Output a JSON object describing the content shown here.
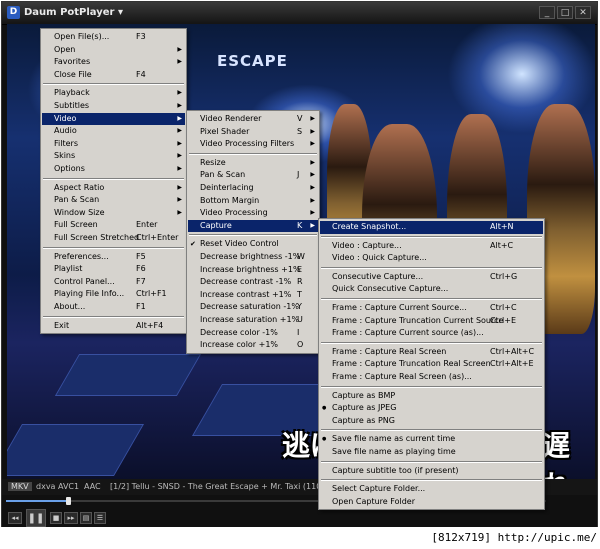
{
  "window": {
    "title": "Daum PotPlayer",
    "title_arrow": "▾"
  },
  "video_overlay": {
    "sign_text": "ESCAPE",
    "subtitle_left": "逃げ",
    "subtitle_right": "遅れ"
  },
  "main_menu": {
    "groups": [
      [
        {
          "label": "Open File(s)...",
          "shortcut": "F3"
        },
        {
          "label": "Open",
          "arrow": true
        },
        {
          "label": "Favorites",
          "arrow": true
        },
        {
          "label": "Close File",
          "shortcut": "F4"
        }
      ],
      [
        {
          "label": "Playback",
          "arrow": true
        },
        {
          "label": "Subtitles",
          "arrow": true
        },
        {
          "label": "Video",
          "arrow": true,
          "highlighted": true
        },
        {
          "label": "Audio",
          "arrow": true
        },
        {
          "label": "Filters",
          "arrow": true
        },
        {
          "label": "Skins",
          "arrow": true
        },
        {
          "label": "Options",
          "arrow": true
        }
      ],
      [
        {
          "label": "Aspect Ratio",
          "arrow": true
        },
        {
          "label": "Pan & Scan",
          "arrow": true
        },
        {
          "label": "Window Size",
          "arrow": true
        },
        {
          "label": "Full Screen",
          "shortcut": "Enter"
        },
        {
          "label": "Full Screen Stretched",
          "shortcut": "Ctrl+Enter"
        }
      ],
      [
        {
          "label": "Preferences...",
          "shortcut": "F5"
        },
        {
          "label": "Playlist",
          "shortcut": "F6"
        },
        {
          "label": "Control Panel...",
          "shortcut": "F7"
        },
        {
          "label": "Playing File Info...",
          "shortcut": "Ctrl+F1"
        },
        {
          "label": "About...",
          "shortcut": "F1"
        }
      ],
      [
        {
          "label": "Exit",
          "shortcut": "Alt+F4"
        }
      ]
    ]
  },
  "video_menu": {
    "groups": [
      [
        {
          "label": "Video Renderer",
          "shortcut": "V",
          "arrow": true
        },
        {
          "label": "Pixel Shader",
          "shortcut": "S",
          "arrow": true
        },
        {
          "label": "Video Processing Filters",
          "arrow": true
        }
      ],
      [
        {
          "label": "Resize",
          "arrow": true
        },
        {
          "label": "Pan & Scan",
          "shortcut": "J",
          "arrow": true
        },
        {
          "label": "Deinterlacing",
          "arrow": true
        },
        {
          "label": "Bottom Margin",
          "arrow": true
        },
        {
          "label": "Video Processing",
          "arrow": true
        },
        {
          "label": "Capture",
          "shortcut": "K",
          "arrow": true,
          "highlighted": true
        }
      ],
      [
        {
          "label": "Reset Video Control",
          "checked": true
        },
        {
          "label": "Decrease brightness -1%",
          "shortcut": "W"
        },
        {
          "label": "Increase brightness +1%",
          "shortcut": "E"
        },
        {
          "label": "Decrease contrast -1%",
          "shortcut": "R"
        },
        {
          "label": "Increase contrast +1%",
          "shortcut": "T"
        },
        {
          "label": "Decrease saturation -1%",
          "shortcut": "Y"
        },
        {
          "label": "Increase saturation +1%",
          "shortcut": "U"
        },
        {
          "label": "Decrease color -1%",
          "shortcut": "I"
        },
        {
          "label": "Increase color +1%",
          "shortcut": "O"
        }
      ]
    ]
  },
  "capture_menu": {
    "groups": [
      [
        {
          "label": "Create Snapshot...",
          "shortcut": "Alt+N",
          "highlighted": true
        }
      ],
      [
        {
          "label": "Video : Capture...",
          "shortcut": "Alt+C"
        },
        {
          "label": "Video : Quick Capture..."
        }
      ],
      [
        {
          "label": "Consecutive Capture...",
          "shortcut": "Ctrl+G"
        },
        {
          "label": "Quick Consecutive Capture..."
        }
      ],
      [
        {
          "label": "Frame : Capture Current Source...",
          "shortcut": "Ctrl+C"
        },
        {
          "label": "Frame : Capture Truncation Current Source",
          "shortcut": "Ctrl+E"
        },
        {
          "label": "Frame : Capture Current source (as)..."
        }
      ],
      [
        {
          "label": "Frame : Capture Real Screen",
          "shortcut": "Ctrl+Alt+C"
        },
        {
          "label": "Frame : Capture Truncation Real Screen",
          "shortcut": "Ctrl+Alt+E"
        },
        {
          "label": "Frame : Capture Real Screen (as)..."
        }
      ],
      [
        {
          "label": "Capture as BMP"
        },
        {
          "label": "Capture as JPEG",
          "radio": true
        },
        {
          "label": "Capture as PNG"
        }
      ],
      [
        {
          "label": "Save file name as current time",
          "radio": true
        },
        {
          "label": "Save file name as playing time"
        }
      ],
      [
        {
          "label": "Capture subtitle too (if present)"
        }
      ],
      [
        {
          "label": "Select Capture Folder..."
        },
        {
          "label": "Open Capture Folder"
        }
      ]
    ]
  },
  "status": {
    "container": "MKV",
    "video_codec": "dxva",
    "video_format": "AVC1",
    "audio_codec": "AAC",
    "now_playing": "[1/2] Tellu - SNSD - The Great Escape + Mr. Taxi (110603 M"
  },
  "seek": {
    "progress": 0.115
  },
  "controls": {
    "prev": "◂◂",
    "play": "❚❚",
    "stop": "■",
    "next": "▸▸",
    "open": "▤",
    "extra": "☰"
  },
  "watermark": "[812x719] http://upic.me/",
  "colors": {
    "menu_bg": "#d6d3ce",
    "highlight": "#0a246a",
    "seek_fill": "#6aa0e8"
  }
}
